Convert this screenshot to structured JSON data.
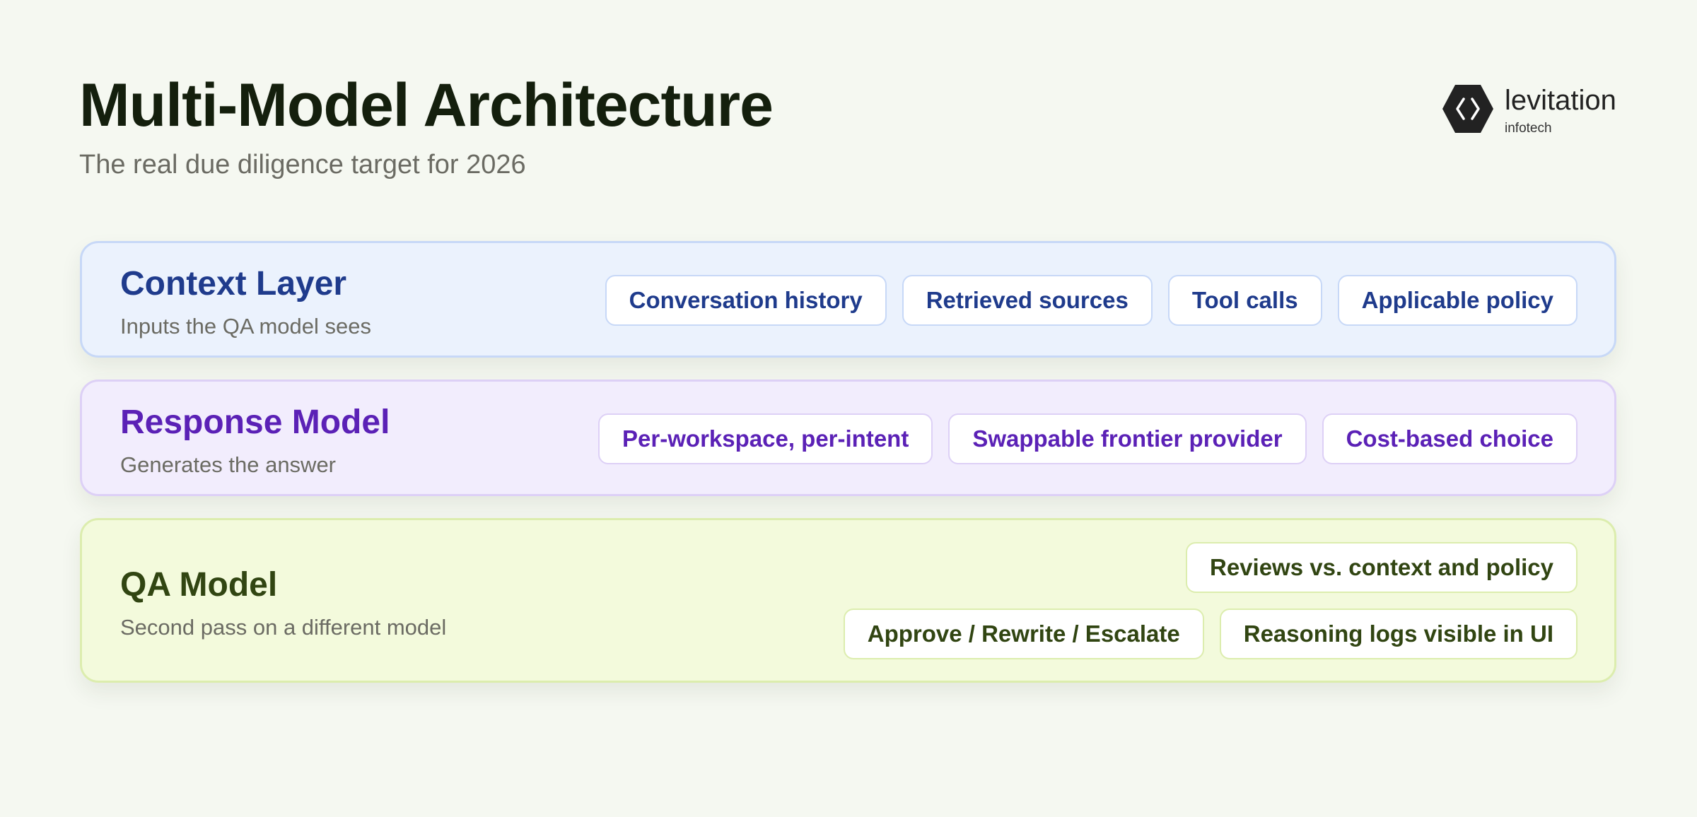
{
  "header": {
    "title": "Multi-Model Architecture",
    "subtitle": "The real due diligence target for 2026"
  },
  "brand": {
    "name": "levitation",
    "sub": "infotech",
    "icon": "hexagon-code-icon"
  },
  "layers": [
    {
      "name": "Context Layer",
      "description": "Inputs the QA model sees",
      "chips": [
        "Conversation history",
        "Retrieved sources",
        "Tool calls",
        "Applicable policy"
      ]
    },
    {
      "name": "Response Model",
      "description": "Generates the answer",
      "chips": [
        "Per-workspace, per-intent",
        "Swappable frontier provider",
        "Cost-based choice"
      ]
    },
    {
      "name": "QA Model",
      "description": "Second pass on a different model",
      "chips": [
        "Reviews vs. context and policy",
        "Approve / Rewrite / Escalate",
        "Reasoning logs visible in UI"
      ]
    }
  ],
  "colors": {
    "background": "#f5f8f1",
    "title": "#141f0d",
    "context_accent": "#1f3b8c",
    "context_fill": "#ebf2fd",
    "response_accent": "#5b21b6",
    "response_fill": "#f2edfd",
    "qa_accent": "#314512",
    "qa_fill": "#f3fadc"
  }
}
